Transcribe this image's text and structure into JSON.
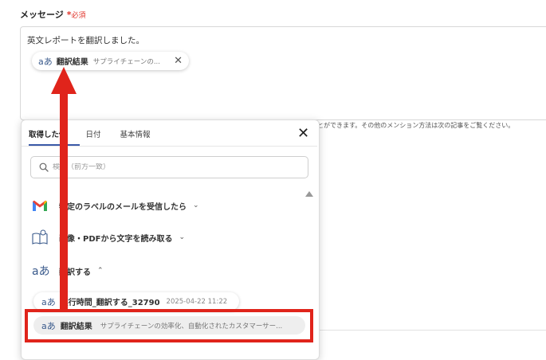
{
  "message_field": {
    "label": "メッセージ",
    "required_mark": "*",
    "required_text": "必須",
    "body_text": "英文レポートを翻訳しました。",
    "chip": {
      "icon": "translate-icon",
      "glyph": "aあ",
      "label": "翻訳結果",
      "value": "サプライチェーンの...",
      "close": "✕"
    },
    "help_text": "とができます。その他のメンション方法は次の記事をご覧ください。"
  },
  "panel": {
    "tabs": [
      {
        "label": "取得した値",
        "active": true
      },
      {
        "label": "日付",
        "active": false
      },
      {
        "label": "基本情報",
        "active": false
      }
    ],
    "close": "✕",
    "search_placeholder": "検索（前方一致）",
    "sections": [
      {
        "label": "特定のラベルのメールを受信したら",
        "icon": "gmail-icon",
        "expanded": false
      },
      {
        "label": "画像・PDFから文字を読み取る",
        "icon": "ocr-book-icon",
        "expanded": false
      },
      {
        "label": "翻訳する",
        "icon": "translate-icon",
        "expanded": true
      }
    ],
    "chevron_down": "⌄",
    "chevron_up": "⌃",
    "translate_glyph": "aあ",
    "sub_item": {
      "label": "実行時間_翻訳する_32790",
      "timestamp": "2025-04-22 11:22"
    },
    "result_item": {
      "label": "翻訳結果",
      "value": "サプライチェーンの効率化、自動化されたカスタマーサー..."
    }
  },
  "colors": {
    "accent": "#3b5aa8",
    "highlight": "#e0241b",
    "required": "#e0352b"
  }
}
